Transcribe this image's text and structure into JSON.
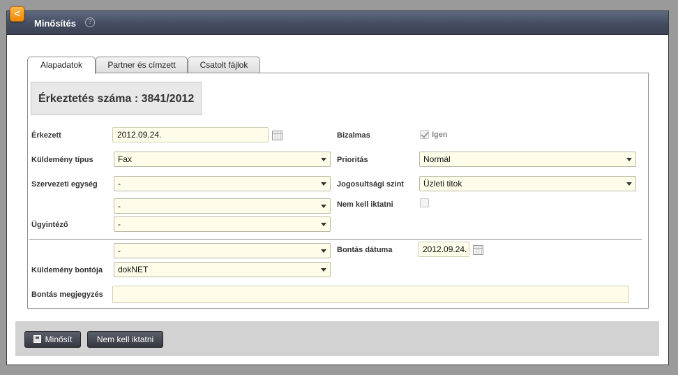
{
  "window": {
    "title": "Minősítés",
    "help_glyph": "?",
    "back_glyph": "<"
  },
  "tabs": [
    {
      "label": "Alapadatok",
      "active": true
    },
    {
      "label": "Partner és címzett",
      "active": false
    },
    {
      "label": "Csatolt fájlok",
      "active": false
    }
  ],
  "registration": {
    "text": "Érkeztetés száma : 3841/2012"
  },
  "form": {
    "erkezett": {
      "label": "Érkezett",
      "value": "2012.09.24."
    },
    "kuldemeny_tipus": {
      "label": "Küldemény típus",
      "value": "Fax"
    },
    "szervezeti_egyseg": {
      "label": "Szervezeti egység",
      "value": "-"
    },
    "szervezeti_egyseg_2": {
      "value": "-"
    },
    "ugyintezo": {
      "label": "Ügyintéző",
      "value": "-"
    },
    "bizalmas": {
      "label": "Bizalmas",
      "checkbox_label": "Igen",
      "checked": true
    },
    "prioritas": {
      "label": "Prioritás",
      "value": "Normál"
    },
    "jogosultsagi_szint": {
      "label": "Jogosultsági szint",
      "value": "Üzleti titok"
    },
    "nem_kell_iktatni": {
      "label": "Nem kell iktatni",
      "checked": false
    },
    "bonto_select": {
      "value": "-"
    },
    "kuldemeny_bontoja": {
      "label": "Küldemény bontója",
      "value": "dokNET"
    },
    "bontas_datuma": {
      "label": "Bontás dátuma",
      "value": "2012.09.24."
    },
    "bontas_megjegyzes": {
      "label": "Bontás megjegyzés",
      "value": ""
    }
  },
  "footer": {
    "minosit_label": "Minősít",
    "nem_kell_iktatni_label": "Nem kell iktatni"
  },
  "icons": [
    "back-icon",
    "help-icon",
    "calendar-icon",
    "save-icon",
    "dropdown-arrow-icon"
  ],
  "colors": {
    "field_bg": "#fffde9",
    "titlebar": "#444d60",
    "back_button": "#f08a00"
  }
}
